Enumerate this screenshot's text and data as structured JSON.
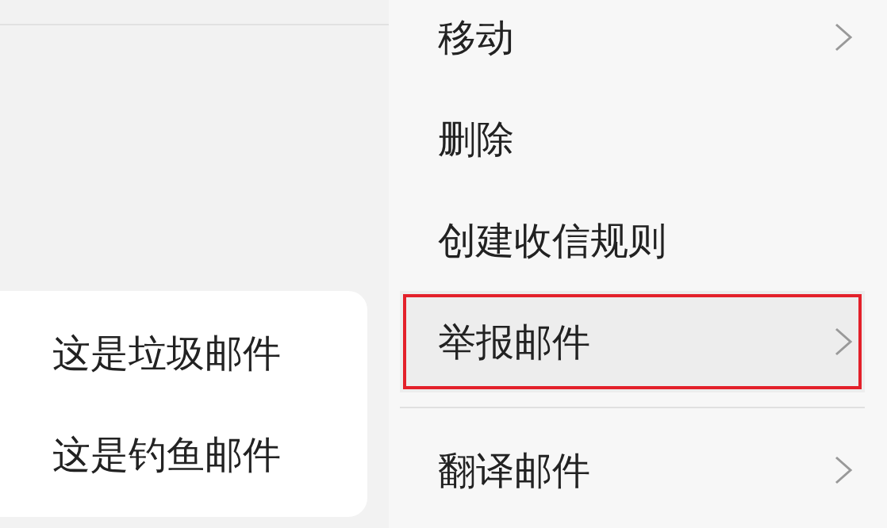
{
  "submenu": {
    "items": [
      {
        "label": "这是垃圾邮件"
      },
      {
        "label": "这是钓鱼邮件"
      }
    ]
  },
  "menu": {
    "items": [
      {
        "label": "移动",
        "has_submenu": true,
        "selected": false,
        "divider_before": false
      },
      {
        "label": "删除",
        "has_submenu": false,
        "selected": false,
        "divider_before": false
      },
      {
        "label": "创建收信规则",
        "has_submenu": false,
        "selected": false,
        "divider_before": false
      },
      {
        "label": "举报邮件",
        "has_submenu": true,
        "selected": true,
        "divider_before": false
      },
      {
        "label": "翻译邮件",
        "has_submenu": true,
        "selected": false,
        "divider_before": true
      }
    ]
  }
}
